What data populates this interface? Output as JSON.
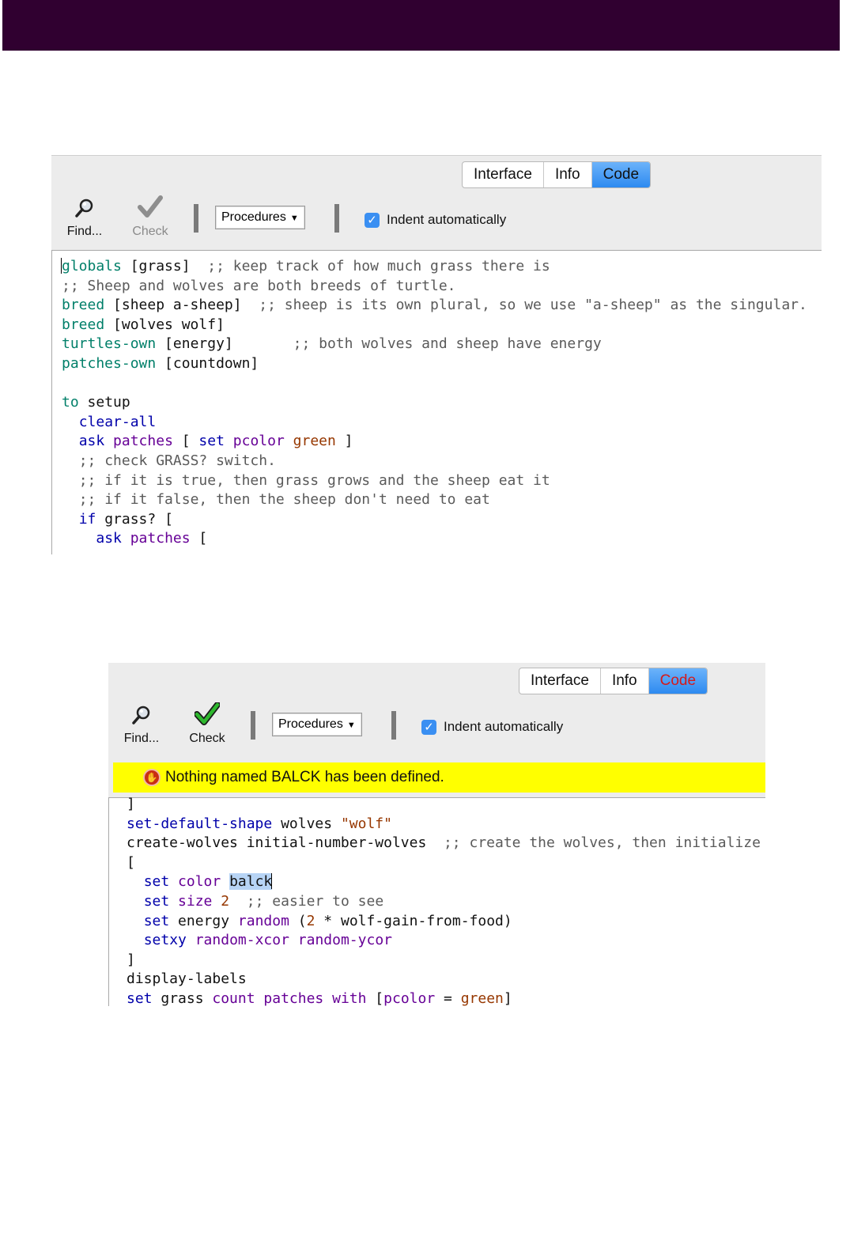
{
  "colors": {
    "header": "#300030",
    "tab_active": "#2d8af0",
    "error_bar": "#ffff00",
    "error_tab_text": "#d61a1a"
  },
  "panel1": {
    "tabs": [
      "Interface",
      "Info",
      "Code"
    ],
    "toolbar": {
      "find_label": "Find...",
      "find_icon": "magnifier-icon",
      "check_label": "Check",
      "check_icon": "gray-checkmark-icon",
      "procedures_label": "Procedures",
      "indent_label": "Indent automatically",
      "indent_checked": true
    },
    "code": [
      [
        [
          "globals",
          "kw-g"
        ],
        [
          " [grass]  ",
          "plain"
        ],
        [
          ";; keep track of how much grass there is",
          "cm"
        ]
      ],
      [
        [
          ";; Sheep and wolves are both breeds of turtle.",
          "cm"
        ]
      ],
      [
        [
          "breed",
          "kw-g"
        ],
        [
          " [sheep a-sheep]  ",
          "plain"
        ],
        [
          ";; sheep is its own plural, so we use \"a-sheep\" as the singular.",
          "cm"
        ]
      ],
      [
        [
          "breed",
          "kw-g"
        ],
        [
          " [wolves wolf]",
          "plain"
        ]
      ],
      [
        [
          "turtles-own",
          "kw-g"
        ],
        [
          " [energy]       ",
          "plain"
        ],
        [
          ";; both wolves and sheep have energy",
          "cm"
        ]
      ],
      [
        [
          "patches-own",
          "kw-g"
        ],
        [
          " [countdown]",
          "plain"
        ]
      ],
      [],
      [
        [
          "to",
          "kw-g"
        ],
        [
          " setup",
          "plain"
        ]
      ],
      [
        [
          "  ",
          "plain"
        ],
        [
          "clear-all",
          "kw-b"
        ]
      ],
      [
        [
          "  ",
          "plain"
        ],
        [
          "ask",
          "kw-b"
        ],
        [
          " ",
          "plain"
        ],
        [
          "patches",
          "kw-p"
        ],
        [
          " [ ",
          "plain"
        ],
        [
          "set",
          "kw-b"
        ],
        [
          " ",
          "plain"
        ],
        [
          "pcolor",
          "kw-p"
        ],
        [
          " ",
          "plain"
        ],
        [
          "green",
          "kw-o"
        ],
        [
          " ]",
          "plain"
        ]
      ],
      [
        [
          "  ",
          "plain"
        ],
        [
          ";; check GRASS? switch.",
          "cm"
        ]
      ],
      [
        [
          "  ",
          "plain"
        ],
        [
          ";; if it is true, then grass grows and the sheep eat it",
          "cm"
        ]
      ],
      [
        [
          "  ",
          "plain"
        ],
        [
          ";; if it false, then the sheep don't need to eat",
          "cm"
        ]
      ],
      [
        [
          "  ",
          "plain"
        ],
        [
          "if",
          "kw-b"
        ],
        [
          " grass? [",
          "plain"
        ]
      ],
      [
        [
          "    ",
          "plain"
        ],
        [
          "ask",
          "kw-b"
        ],
        [
          " ",
          "plain"
        ],
        [
          "patches",
          "kw-p"
        ],
        [
          " [",
          "plain"
        ]
      ]
    ]
  },
  "panel2": {
    "tabs": [
      "Interface",
      "Info",
      "Code"
    ],
    "toolbar": {
      "find_label": "Find...",
      "find_icon": "magnifier-icon",
      "check_label": "Check",
      "check_icon": "green-checkmark-icon",
      "procedures_label": "Procedures",
      "indent_label": "Indent automatically",
      "indent_checked": true
    },
    "error_message": "Nothing named BALCK has been defined.",
    "code": [
      [
        [
          "]",
          "plain"
        ]
      ],
      [
        [
          "set-default-shape",
          "kw-b"
        ],
        [
          " wolves ",
          "plain"
        ],
        [
          "\"wolf\"",
          "kw-o"
        ]
      ],
      [
        [
          "create-wolves initial-number-wolves  ",
          "plain"
        ],
        [
          ";; create the wolves, then initialize",
          "cm"
        ]
      ],
      [
        [
          "[",
          "plain"
        ]
      ],
      [
        [
          "  ",
          "plain"
        ],
        [
          "set",
          "kw-b"
        ],
        [
          " ",
          "plain"
        ],
        [
          "color",
          "kw-p"
        ],
        [
          " ",
          "plain"
        ],
        [
          "balck",
          "sel"
        ]
      ],
      [
        [
          "  ",
          "plain"
        ],
        [
          "set",
          "kw-b"
        ],
        [
          " ",
          "plain"
        ],
        [
          "size",
          "kw-p"
        ],
        [
          " ",
          "plain"
        ],
        [
          "2",
          "kw-o"
        ],
        [
          "  ",
          "plain"
        ],
        [
          ";; easier to see",
          "cm"
        ]
      ],
      [
        [
          "  ",
          "plain"
        ],
        [
          "set",
          "kw-b"
        ],
        [
          " energy ",
          "plain"
        ],
        [
          "random",
          "kw-p"
        ],
        [
          " (",
          "plain"
        ],
        [
          "2",
          "kw-o"
        ],
        [
          " * wolf-gain-from-food)",
          "plain"
        ]
      ],
      [
        [
          "  ",
          "plain"
        ],
        [
          "setxy",
          "kw-b"
        ],
        [
          " ",
          "plain"
        ],
        [
          "random-xcor",
          "kw-p"
        ],
        [
          " ",
          "plain"
        ],
        [
          "random-ycor",
          "kw-p"
        ]
      ],
      [
        [
          "]",
          "plain"
        ]
      ],
      [
        [
          "display-labels",
          "plain"
        ]
      ],
      [
        [
          "set",
          "kw-b"
        ],
        [
          " grass ",
          "plain"
        ],
        [
          "count",
          "kw-p"
        ],
        [
          " ",
          "plain"
        ],
        [
          "patches",
          "kw-p"
        ],
        [
          " ",
          "plain"
        ],
        [
          "with",
          "kw-p"
        ],
        [
          " [",
          "plain"
        ],
        [
          "pcolor",
          "kw-p"
        ],
        [
          " = ",
          "plain"
        ],
        [
          "green",
          "kw-o"
        ],
        [
          "]",
          "plain"
        ]
      ]
    ]
  }
}
